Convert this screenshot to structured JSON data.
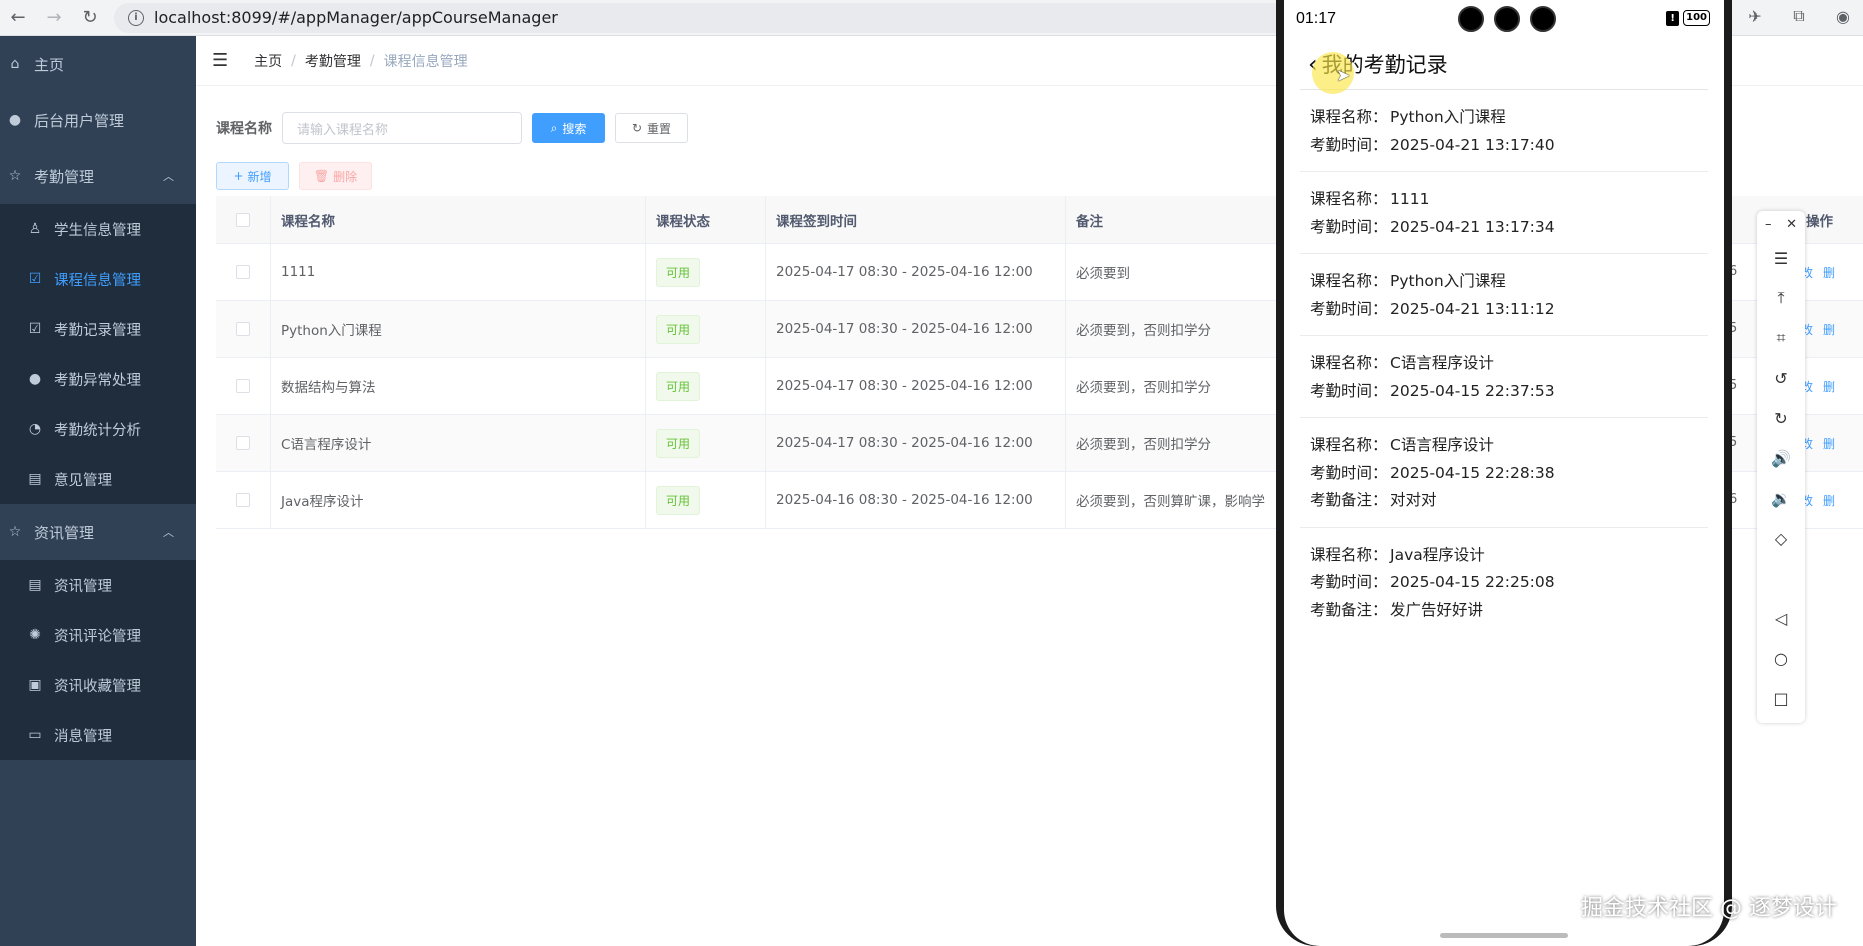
{
  "browser": {
    "url": "localhost:8099/#/appManager/appCourseManager"
  },
  "sidebar": {
    "items": [
      {
        "label": "主页"
      },
      {
        "label": "后台用户管理"
      },
      {
        "label": "考勤管理"
      },
      {
        "label": "资讯管理"
      }
    ],
    "attendance_sub": [
      {
        "label": "学生信息管理"
      },
      {
        "label": "课程信息管理"
      },
      {
        "label": "考勤记录管理"
      },
      {
        "label": "考勤异常处理"
      },
      {
        "label": "考勤统计分析"
      },
      {
        "label": "意见管理"
      }
    ],
    "news_sub": [
      {
        "label": "资讯管理"
      },
      {
        "label": "资讯评论管理"
      },
      {
        "label": "资讯收藏管理"
      },
      {
        "label": "消息管理"
      }
    ]
  },
  "breadcrumb": {
    "home": "主页",
    "section": "考勤管理",
    "current": "课程信息管理"
  },
  "search": {
    "label": "课程名称",
    "placeholder": "请输入课程名称",
    "search_btn": "搜索",
    "reset_btn": "重置"
  },
  "actions": {
    "add": "新增",
    "delete": "删除"
  },
  "table": {
    "headers": {
      "name": "课程名称",
      "status": "课程状态",
      "time": "课程签到时间",
      "note": "备注",
      "ops": "操作"
    },
    "rows": [
      {
        "name": "1111",
        "status": "可用",
        "time": "2025-04-17 08:30 - 2025-04-16 12:00",
        "note": "必须要到",
        "num": "6",
        "op": "改",
        "op2": "删"
      },
      {
        "name": "Python入门课程",
        "status": "可用",
        "time": "2025-04-17 08:30 - 2025-04-16 12:00",
        "note": "必须要到，否则扣学分",
        "num": "5",
        "op": "改",
        "op2": "删"
      },
      {
        "name": "数据结构与算法",
        "status": "可用",
        "time": "2025-04-17 08:30 - 2025-04-16 12:00",
        "note": "必须要到，否则扣学分",
        "num": "5",
        "op": "改",
        "op2": "删"
      },
      {
        "name": "C语言程序设计",
        "status": "可用",
        "time": "2025-04-17 08:30 - 2025-04-16 12:00",
        "note": "必须要到，否则扣学分",
        "num": "5",
        "op": "改",
        "op2": "删"
      },
      {
        "name": "Java程序设计",
        "status": "可用",
        "time": "2025-04-16 08:30 - 2025-04-16 12:00",
        "note": "必须要到，否则算旷课，影响学",
        "num": "6",
        "op": "改",
        "op2": "删"
      }
    ]
  },
  "phone": {
    "time": "01:17",
    "battery": "100",
    "title": "我的考勤记录",
    "keys": {
      "course": "课程名称：",
      "time": "考勤时间：",
      "note": "考勤备注："
    },
    "records": [
      {
        "course": "Python入门课程",
        "time": "2025-04-21 13:17:40"
      },
      {
        "course": "1111",
        "time": "2025-04-21 13:17:34"
      },
      {
        "course": "Python入门课程",
        "time": "2025-04-21 13:11:12"
      },
      {
        "course": "C语言程序设计",
        "time": "2025-04-15 22:37:53"
      },
      {
        "course": "C语言程序设计",
        "time": "2025-04-15 22:28:38",
        "note": "对对对"
      },
      {
        "course": "Java程序设计",
        "time": "2025-04-15 22:25:08",
        "note": "发广告好好讲"
      }
    ]
  },
  "watermark": "掘金技术社区 @ 逐梦设计"
}
